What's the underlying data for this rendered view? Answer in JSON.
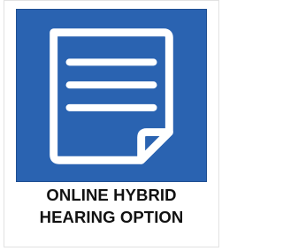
{
  "tile": {
    "label_line1": "ONLINE HYBRID",
    "label_line2": "HEARING OPTION",
    "icon": "document-icon"
  },
  "colors": {
    "icon_background": "#2a63b1",
    "icon_foreground": "#ffffff",
    "label_text": "#111111"
  }
}
